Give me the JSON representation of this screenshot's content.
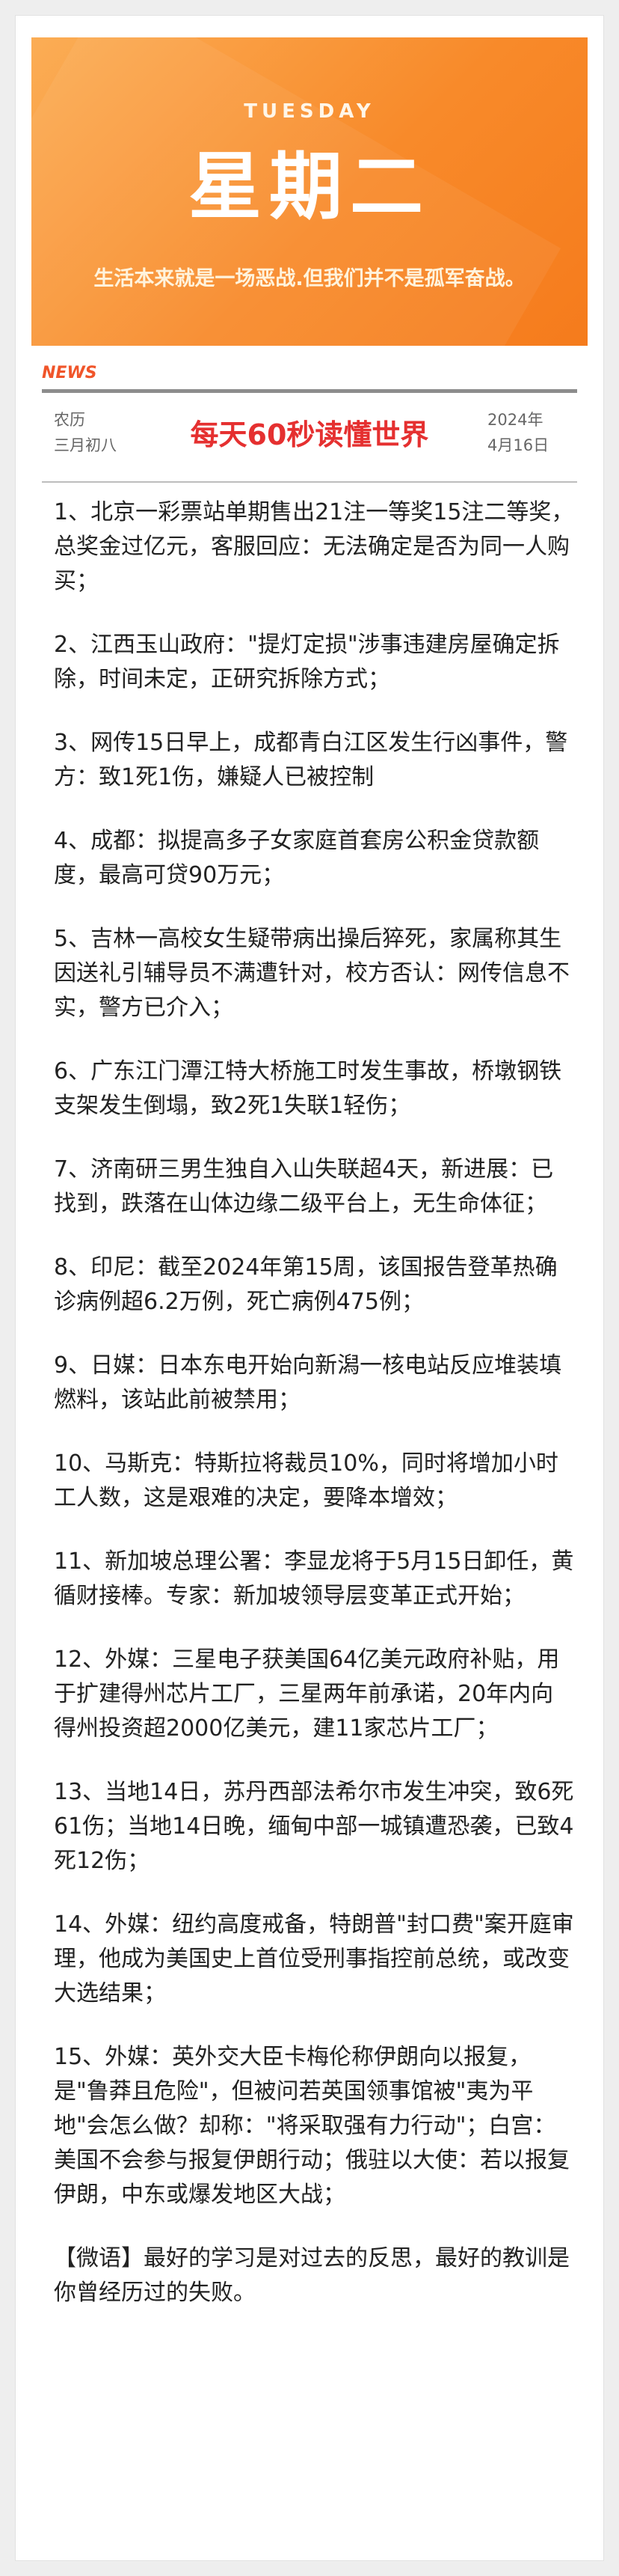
{
  "banner": {
    "day_en": "TUESDAY",
    "day_cn": "星期二",
    "motto": "生活本来就是一场恶战.但我们并不是孤军奋战。"
  },
  "header": {
    "tag": "NEWS",
    "lunar_label": "农历",
    "lunar_date": "三月初八",
    "headline": "每天60秒读懂世界",
    "year": "2024年",
    "date": "4月16日"
  },
  "items": [
    "1、北京一彩票站单期售出21注一等奖15注二等奖，总奖金过亿元，客服回应：无法确定是否为同一人购买；",
    "2、江西玉山政府：\"提灯定损\"涉事违建房屋确定拆除，时间未定，正研究拆除方式；",
    "3、网传15日早上，成都青白江区发生行凶事件，警方：致1死1伤，嫌疑人已被控制",
    "4、成都：拟提高多子女家庭首套房公积金贷款额度，最高可贷90万元；",
    "5、吉林一高校女生疑带病出操后猝死，家属称其生因送礼引辅导员不满遭针对，校方否认：网传信息不实，警方已介入；",
    "6、广东江门潭江特大桥施工时发生事故，桥墩钢铁支架发生倒塌，致2死1失联1轻伤；",
    "7、济南研三男生独自入山失联超4天，新进展：已找到，跌落在山体边缘二级平台上，无生命体征；",
    "8、印尼：截至2024年第15周，该国报告登革热确诊病例超6.2万例，死亡病例475例；",
    "9、日媒：日本东电开始向新潟一核电站反应堆装填燃料，该站此前被禁用；",
    "10、马斯克：特斯拉将裁员10%，同时将增加小时工人数，这是艰难的决定，要降本增效；",
    "11、新加坡总理公署：李显龙将于5月15日卸任，黄循财接棒。专家：新加坡领导层变革正式开始；",
    "12、外媒：三星电子获美国64亿美元政府补贴，用于扩建得州芯片工厂，三星两年前承诺，20年内向得州投资超2000亿美元，建11家芯片工厂；",
    "13、当地14日，苏丹西部法希尔市发生冲突，致6死61伤；当地14日晚，缅甸中部一城镇遭恐袭，已致4死12伤；",
    "14、外媒：纽约高度戒备，特朗普\"封口费\"案开庭审理，他成为美国史上首位受刑事指控前总统，或改变大选结果；",
    "15、外媒：英外交大臣卡梅伦称伊朗向以报复，是\"鲁莽且危险\"，但被问若英国领事馆被\"夷为平地\"会怎么做？却称：\"将采取强有力行动\"；白宫：美国不会参与报复伊朗行动；俄驻以大使：若以报复伊朗，中东或爆发地区大战；"
  ],
  "quote": "【微语】最好的学习是对过去的反思，最好的教训是你曾经历过的失败。",
  "colors": {
    "banner": "#f88a2a",
    "headline": "#e53030",
    "news_tag": "#f0552a"
  }
}
